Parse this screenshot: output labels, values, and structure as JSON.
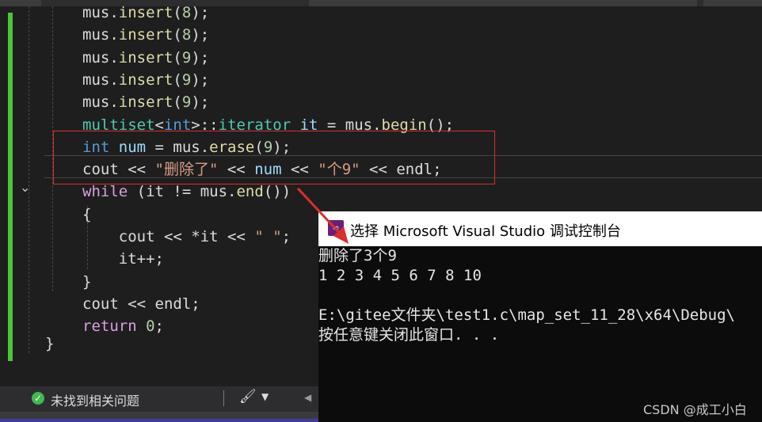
{
  "code": {
    "lines": [
      {
        "parts": [
          {
            "t": "mus.",
            "c": ""
          },
          {
            "t": "insert",
            "c": "fn"
          },
          {
            "t": "(",
            "c": ""
          },
          {
            "t": "8",
            "c": "num"
          },
          {
            "t": ");",
            "c": ""
          }
        ]
      },
      {
        "parts": [
          {
            "t": "mus.",
            "c": ""
          },
          {
            "t": "insert",
            "c": "fn"
          },
          {
            "t": "(",
            "c": ""
          },
          {
            "t": "8",
            "c": "num"
          },
          {
            "t": ");",
            "c": ""
          }
        ]
      },
      {
        "parts": [
          {
            "t": "mus.",
            "c": ""
          },
          {
            "t": "insert",
            "c": "fn"
          },
          {
            "t": "(",
            "c": ""
          },
          {
            "t": "9",
            "c": "num"
          },
          {
            "t": ");",
            "c": ""
          }
        ]
      },
      {
        "parts": [
          {
            "t": "mus.",
            "c": ""
          },
          {
            "t": "insert",
            "c": "fn"
          },
          {
            "t": "(",
            "c": ""
          },
          {
            "t": "9",
            "c": "num"
          },
          {
            "t": ");",
            "c": ""
          }
        ]
      },
      {
        "parts": [
          {
            "t": "mus.",
            "c": ""
          },
          {
            "t": "insert",
            "c": "fn"
          },
          {
            "t": "(",
            "c": ""
          },
          {
            "t": "9",
            "c": "num"
          },
          {
            "t": ");",
            "c": ""
          }
        ]
      },
      {
        "parts": [
          {
            "t": "multiset",
            "c": "ty"
          },
          {
            "t": "<",
            "c": ""
          },
          {
            "t": "int",
            "c": "kw"
          },
          {
            "t": ">::",
            "c": ""
          },
          {
            "t": "iterator",
            "c": "ty"
          },
          {
            "t": " it",
            "c": "var"
          },
          {
            "t": " = mus.",
            "c": ""
          },
          {
            "t": "begin",
            "c": "fn"
          },
          {
            "t": "();",
            "c": ""
          }
        ]
      },
      {
        "parts": [
          {
            "t": "int",
            "c": "kw"
          },
          {
            "t": " num",
            "c": "var"
          },
          {
            "t": " = mus.",
            "c": ""
          },
          {
            "t": "erase",
            "c": "fn"
          },
          {
            "t": "(",
            "c": ""
          },
          {
            "t": "9",
            "c": "num"
          },
          {
            "t": ");",
            "c": ""
          }
        ]
      },
      {
        "parts": [
          {
            "t": "cout ",
            "c": ""
          },
          {
            "t": "<<",
            "c": ""
          },
          {
            "t": " \"删除了\" ",
            "c": "str"
          },
          {
            "t": "<< ",
            "c": ""
          },
          {
            "t": "num",
            "c": "var"
          },
          {
            "t": " << ",
            "c": ""
          },
          {
            "t": "\"个9\"",
            "c": "str"
          },
          {
            "t": " << endl;",
            "c": ""
          }
        ]
      },
      {
        "parts": [
          {
            "t": "while",
            "c": "kwc"
          },
          {
            "t": " (it != mus.",
            "c": ""
          },
          {
            "t": "end",
            "c": "fn"
          },
          {
            "t": "())",
            "c": ""
          }
        ]
      },
      {
        "parts": [
          {
            "t": "{",
            "c": ""
          }
        ]
      },
      {
        "parts": [
          {
            "t": "    cout << *it << ",
            "c": ""
          },
          {
            "t": "\" \"",
            "c": "str"
          },
          {
            "t": ";",
            "c": ""
          }
        ]
      },
      {
        "parts": [
          {
            "t": "    it++;",
            "c": ""
          }
        ]
      },
      {
        "parts": [
          {
            "t": "}",
            "c": ""
          }
        ]
      },
      {
        "parts": [
          {
            "t": "cout << endl;",
            "c": ""
          }
        ]
      },
      {
        "parts": [
          {
            "t": "return",
            "c": "kwc"
          },
          {
            "t": " ",
            "c": ""
          },
          {
            "t": "0",
            "c": "num"
          },
          {
            "t": ";",
            "c": ""
          }
        ]
      }
    ],
    "closing_brace": "}"
  },
  "status": {
    "message": "未找到相关问题",
    "check_icon": "check-circle-icon",
    "brush_icon": "brush-icon"
  },
  "console": {
    "title": "选择 Microsoft Visual Studio 调试控制台",
    "output": [
      "删除了3个9",
      "1 2 3 4 5 6 7 8 10",
      "",
      "E:\\gitee文件夹\\test1.c\\map_set_11_28\\x64\\Debug\\",
      "按任意键关闭此窗口. . ."
    ]
  },
  "watermark": "CSDN @成工小白",
  "colors": {
    "highlight_box": "#d9302c",
    "arrow": "#d9302c",
    "breakpoint_bar": "#4ec33c"
  }
}
